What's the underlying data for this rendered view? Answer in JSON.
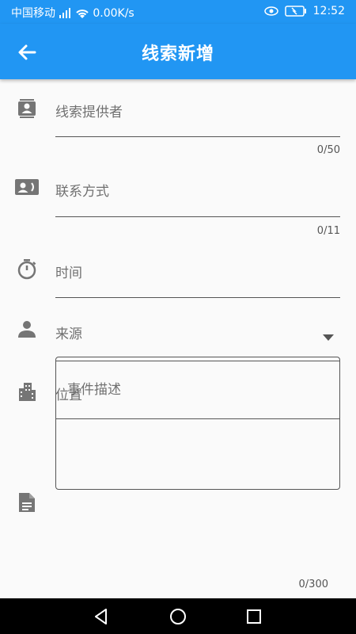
{
  "status_bar": {
    "carrier": "中国移动",
    "network_speed": "0.00K/s",
    "time": "12:52"
  },
  "app_bar": {
    "title": "线索新增",
    "back_icon": "arrow-left-icon"
  },
  "form": {
    "provider": {
      "label": "线索提供者",
      "counter": "0/50",
      "icon": "contact-book-icon"
    },
    "contact": {
      "label": "联系方式",
      "counter": "0/11",
      "icon": "contact-card-icon"
    },
    "time": {
      "label": "时间",
      "icon": "timer-icon"
    },
    "source": {
      "label": "来源",
      "icon": "person-icon",
      "dropdown_icon": "caret-down-icon"
    },
    "location": {
      "label": "位置",
      "icon": "building-icon"
    },
    "description": {
      "placeholder": "事件描述",
      "counter": "0/300",
      "icon": "document-icon"
    }
  },
  "colors": {
    "primary": "#2196F3",
    "icon_gray": "#757575",
    "background": "#fafafa"
  },
  "nav_bar": {
    "back_icon": "triangle-back-icon",
    "home_icon": "circle-home-icon",
    "recents_icon": "square-recents-icon"
  }
}
